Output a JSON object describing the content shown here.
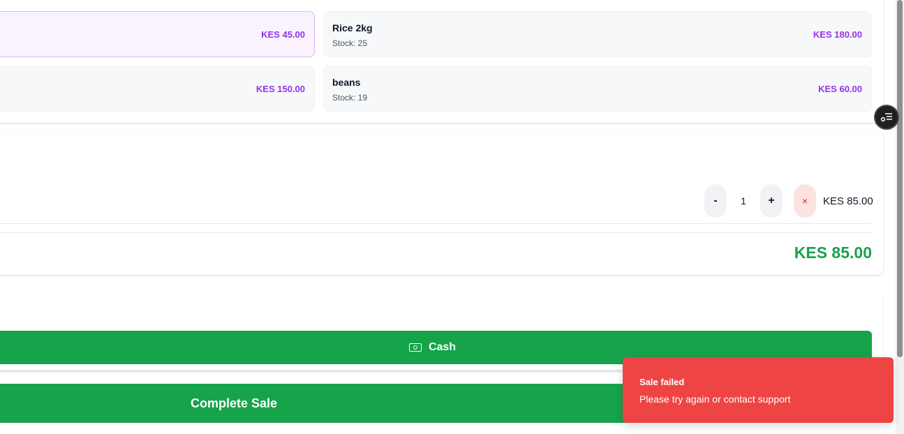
{
  "products": [
    {
      "name": "",
      "stock": "",
      "price": "KES 45.00",
      "selected": true
    },
    {
      "name": "Rice 2kg",
      "stock": "Stock: 25",
      "price": "KES 180.00",
      "selected": false
    },
    {
      "name": "",
      "stock": "",
      "price": "KES 150.00",
      "selected": false
    },
    {
      "name": "beans",
      "stock": "Stock: 19",
      "price": "KES 60.00",
      "selected": false
    }
  ],
  "cart": {
    "item": {
      "decrement_label": "-",
      "quantity": "1",
      "increment_label": "+",
      "remove_label": "×",
      "line_total": "KES 85.00"
    },
    "total": "KES 85.00"
  },
  "payment": {
    "cash_label": "Cash",
    "complete_label": "Complete Sale"
  },
  "toast": {
    "title": "Sale failed",
    "message": "Please try again or contact support"
  },
  "colors": {
    "accent_green": "#16a34a",
    "price_purple": "#9333ea",
    "error_red": "#ef4444"
  },
  "icons": [
    "cash-icon",
    "filter-icon"
  ]
}
